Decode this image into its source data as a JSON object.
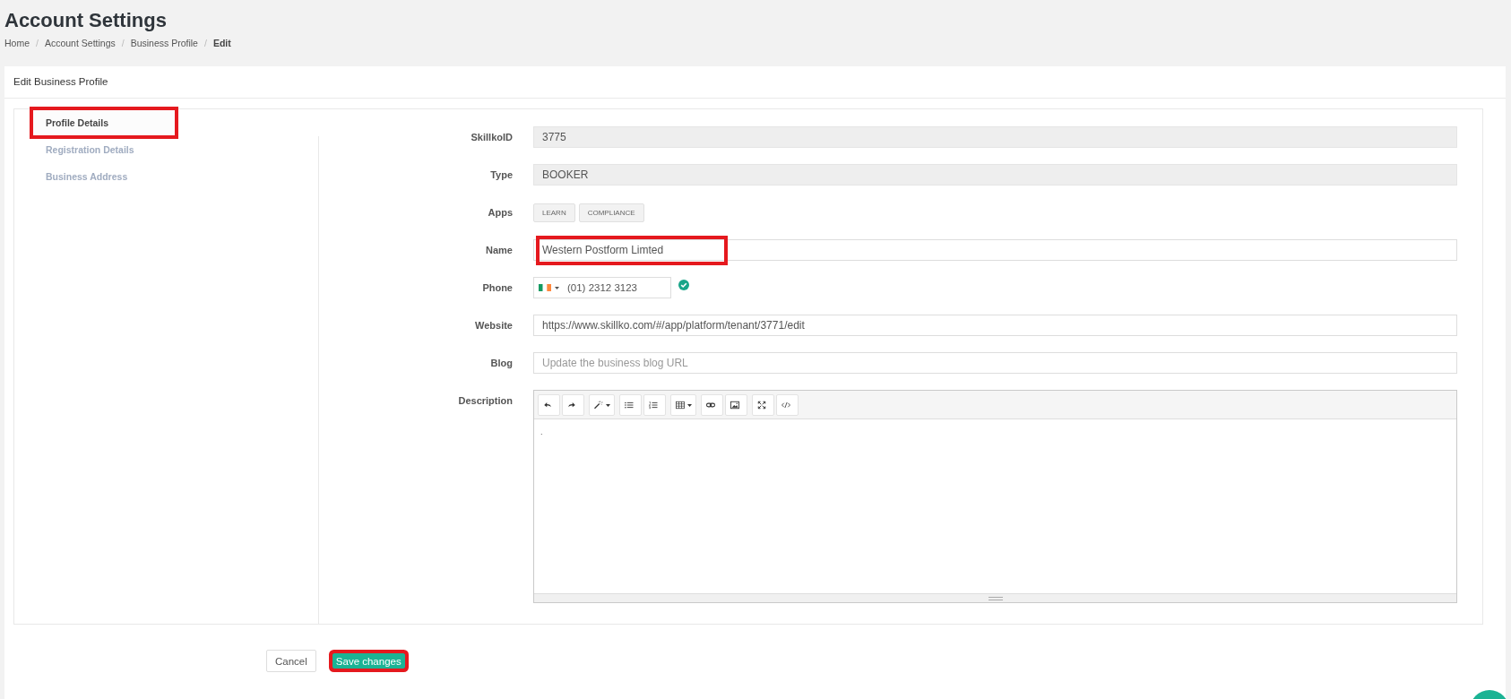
{
  "page": {
    "title": "Account Settings",
    "separator": "/",
    "breadcrumb": [
      {
        "label": "Home",
        "current": false
      },
      {
        "label": "Account Settings",
        "current": false
      },
      {
        "label": "Business Profile",
        "current": false
      },
      {
        "label": "Edit",
        "current": true
      }
    ]
  },
  "card": {
    "title": "Edit Business Profile"
  },
  "tabs": [
    {
      "label": "Profile Details",
      "selected": true,
      "highlighted": true
    },
    {
      "label": "Registration Details",
      "selected": false,
      "highlighted": false
    },
    {
      "label": "Business Address",
      "selected": false,
      "highlighted": false
    }
  ],
  "fields": [
    {
      "kind": "readonly",
      "label": "SkillkoID",
      "value": "3775",
      "highlighted": false
    },
    {
      "kind": "readonly",
      "label": "Type",
      "value": "BOOKER",
      "highlighted": false
    },
    {
      "kind": "tags",
      "label": "Apps",
      "tags": [
        "LEARN",
        "COMPLIANCE"
      ],
      "highlighted": false
    },
    {
      "kind": "text",
      "label": "Name",
      "value": "Western Postform Limted",
      "highlighted": true
    },
    {
      "kind": "phone",
      "label": "Phone",
      "value": "(01) 2312 3123",
      "verified": true,
      "highlighted": false
    },
    {
      "kind": "text",
      "label": "Website",
      "value": "https://www.skillko.com/#/app/platform/tenant/3771/edit",
      "highlighted": false
    },
    {
      "kind": "text",
      "label": "Blog",
      "placeholder": "Update the business blog URL",
      "highlighted": false
    },
    {
      "kind": "editor",
      "label": "Description",
      "value": ".",
      "highlighted": false
    }
  ],
  "buttons": [
    {
      "kind": "secondary",
      "label": "Cancel",
      "highlighted": false
    },
    {
      "kind": "primary",
      "label": "Save changes",
      "highlighted": true
    }
  ]
}
